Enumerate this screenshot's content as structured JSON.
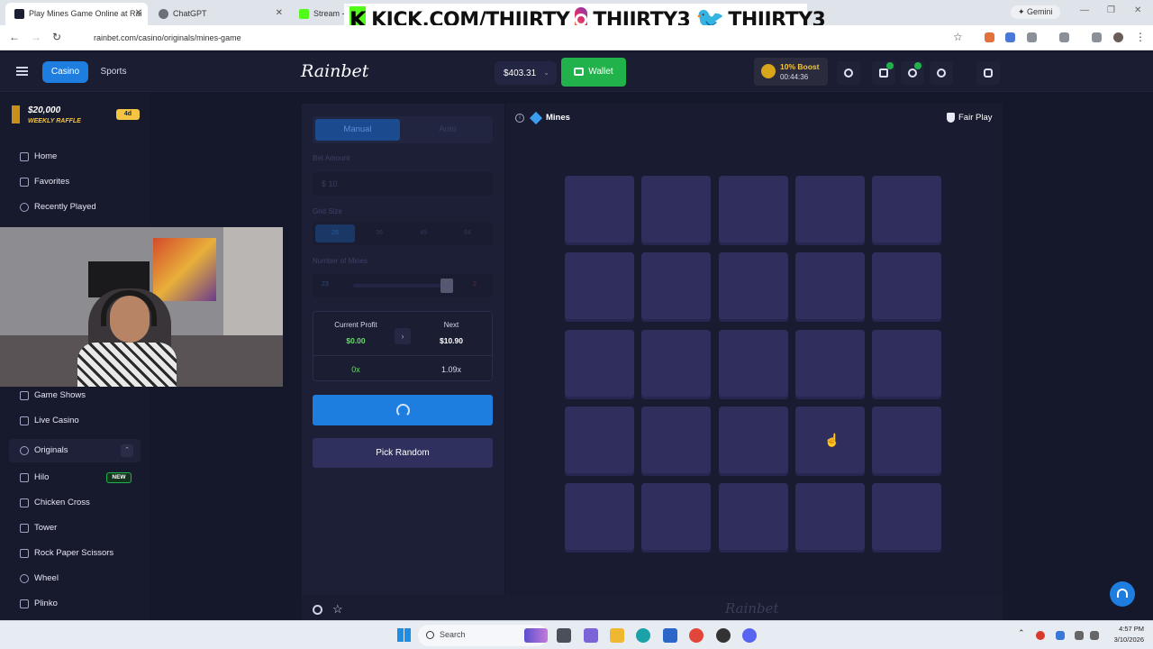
{
  "browser": {
    "tabs": [
      {
        "title": "Play Mines Game Online at Rai",
        "favicon_color": "#1b1d33"
      },
      {
        "title": "ChatGPT",
        "favicon_color": "#6b6f76"
      },
      {
        "title": "Stream -",
        "favicon_color": "#53fc18"
      }
    ],
    "gemini_label": "Gemini",
    "url": "rainbet.com/casino/originals/mines-game"
  },
  "stream_overlay": {
    "kick": "KICK.COM/THIIRTY",
    "instagram": "THIIRTY3",
    "twitter": "THIIRTY3"
  },
  "header": {
    "casino_label": "Casino",
    "sports_label": "Sports",
    "logo_text": "Rainbet",
    "balance": "$403.31",
    "wallet_label": "Wallet",
    "boost_title": "10% Boost",
    "boost_timer": "00:44:36",
    "accent_color": "#1e7ee0",
    "wallet_color": "#22b24c"
  },
  "sidebar": {
    "raffle_amount": "$20,000",
    "raffle_label": "WEEKLY RAFFLE",
    "raffle_days": "4d",
    "nav_top": [
      {
        "label": "Home",
        "icon": "crown-icon"
      },
      {
        "label": "Favorites",
        "icon": "star-icon"
      },
      {
        "label": "Recently Played",
        "icon": "clock-icon"
      }
    ],
    "nav_mid": [
      {
        "label": "Game Shows",
        "icon": "tv-icon"
      },
      {
        "label": "Live Casino",
        "icon": "live-icon"
      }
    ],
    "originals_label": "Originals",
    "originals_items": [
      {
        "label": "Hilo",
        "badge": "NEW"
      },
      {
        "label": "Chicken Cross",
        "badge": ""
      },
      {
        "label": "Tower",
        "badge": ""
      },
      {
        "label": "Rock Paper Scissors",
        "badge": ""
      },
      {
        "label": "Wheel",
        "badge": ""
      },
      {
        "label": "Plinko",
        "badge": ""
      }
    ]
  },
  "bet_panel": {
    "manual_label": "Manual",
    "auto_label": "Auto",
    "bet_amount_label": "Bet Amount",
    "bet_amount_value": "$ 10",
    "grid_size_label": "Grid Size",
    "grid_sizes": [
      "25",
      "36",
      "49",
      "64"
    ],
    "mines_label": "Number of Mines",
    "mines_gems": "23",
    "mines_bombs": "2",
    "current_profit_label": "Current Profit",
    "current_profit_value": "$0.00",
    "next_label": "Next",
    "next_value": "$10.90",
    "current_multiplier": "0x",
    "next_multiplier": "1.09x",
    "pick_random_label": "Pick Random",
    "profit_color": "#6bd96b"
  },
  "game": {
    "title": "Mines",
    "fair_play_label": "Fair Play",
    "grid_rows": 5,
    "grid_cols": 5,
    "footer_logo": "Rainbet"
  },
  "taskbar": {
    "search_placeholder": "Search",
    "time": "4:57 PM",
    "date": "3/10/2026"
  }
}
